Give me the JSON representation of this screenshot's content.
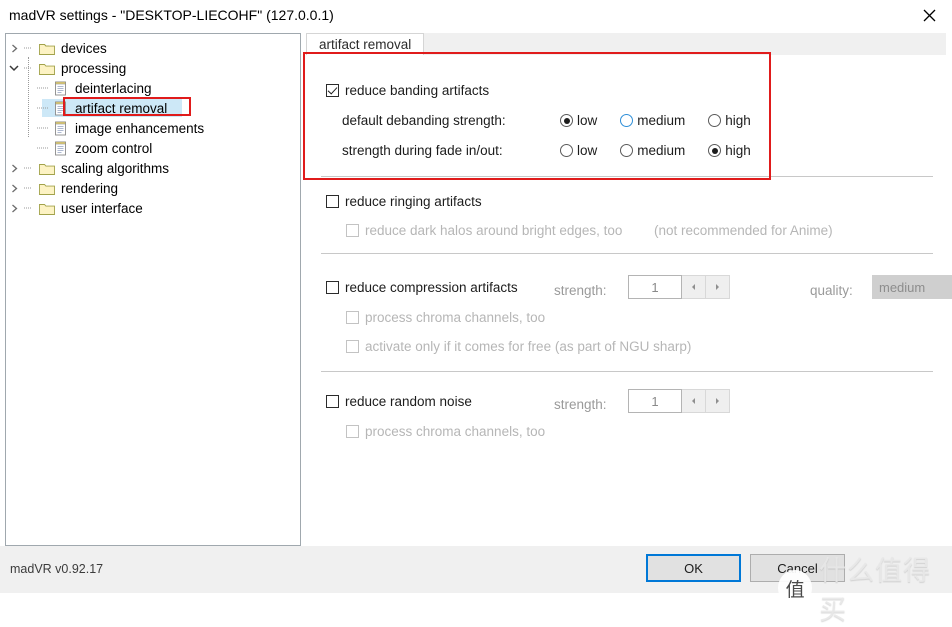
{
  "window": {
    "title": "madVR settings - \"DESKTOP-LIECOHF\" (127.0.0.1)",
    "close_icon": "close-icon"
  },
  "sidebar": {
    "items": [
      {
        "label": "devices",
        "level": 0,
        "type": "folder",
        "expanded": false,
        "selected": false
      },
      {
        "label": "processing",
        "level": 0,
        "type": "folder",
        "expanded": true,
        "selected": false
      },
      {
        "label": "deinterlacing",
        "level": 1,
        "type": "page",
        "selected": false
      },
      {
        "label": "artifact removal",
        "level": 1,
        "type": "page",
        "selected": true
      },
      {
        "label": "image enhancements",
        "level": 1,
        "type": "page",
        "selected": false
      },
      {
        "label": "zoom control",
        "level": 1,
        "type": "page",
        "selected": false
      },
      {
        "label": "scaling algorithms",
        "level": 0,
        "type": "folder",
        "expanded": false,
        "selected": false
      },
      {
        "label": "rendering",
        "level": 0,
        "type": "folder",
        "expanded": false,
        "selected": false
      },
      {
        "label": "user interface",
        "level": 0,
        "type": "folder",
        "expanded": false,
        "selected": false
      }
    ]
  },
  "tab": {
    "label": "artifact removal"
  },
  "banding": {
    "checkbox_label": "reduce banding artifacts",
    "checked": true,
    "default_strength": {
      "label": "default debanding strength:",
      "options": [
        "low",
        "medium",
        "high"
      ],
      "selected": "low",
      "hovered": "medium"
    },
    "fade_strength": {
      "label": "strength during fade in/out:",
      "options": [
        "low",
        "medium",
        "high"
      ],
      "selected": "high",
      "hovered": null
    }
  },
  "ringing": {
    "checkbox_label": "reduce ringing artifacts",
    "checked": false,
    "sub_label": "reduce dark halos around bright edges, too",
    "sub_checked": false,
    "note": "(not recommended for Anime)"
  },
  "compression": {
    "checkbox_label": "reduce compression artifacts",
    "checked": false,
    "strength_label": "strength:",
    "strength_value": "1",
    "quality_label": "quality:",
    "quality_value": "medium",
    "sub_items": [
      {
        "label": "process chroma channels, too",
        "checked": false
      },
      {
        "label": "activate only if it comes for free (as part of NGU sharp)",
        "checked": false
      }
    ]
  },
  "noise": {
    "checkbox_label": "reduce random noise",
    "checked": false,
    "strength_label": "strength:",
    "strength_value": "1",
    "sub_items": [
      {
        "label": "process chroma channels, too",
        "checked": false
      }
    ]
  },
  "footer": {
    "version": "madVR v0.92.17",
    "ok_label": "OK",
    "cancel_label": "Cancel"
  },
  "watermark": {
    "logo_char": "值",
    "text": "什么值得买"
  },
  "colors": {
    "annotation": "#e01b1b",
    "selection": "#cde8f7",
    "focus": "#0078d7"
  }
}
